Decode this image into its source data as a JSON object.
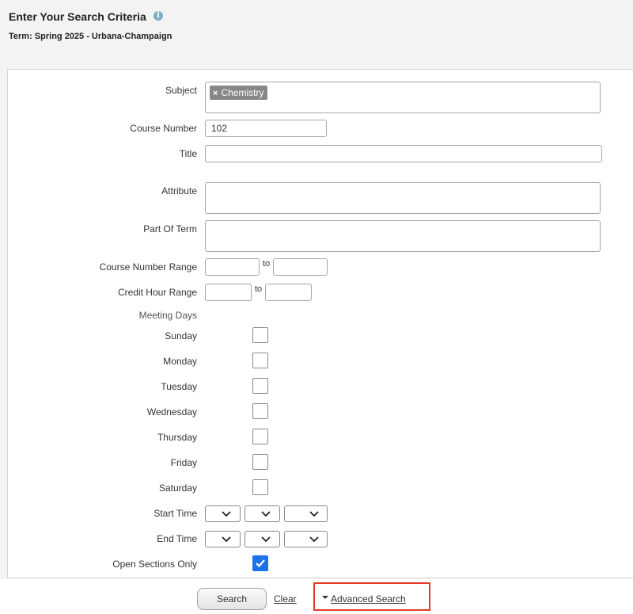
{
  "header": {
    "title": "Enter Your Search Criteria",
    "info_icon": "info-icon",
    "term": "Term: Spring 2025 - Urbana-Champaign"
  },
  "form": {
    "subject": {
      "label": "Subject",
      "chips": [
        "Chemistry"
      ]
    },
    "course_number": {
      "label": "Course Number",
      "value": "102"
    },
    "title": {
      "label": "Title",
      "value": ""
    },
    "attribute": {
      "label": "Attribute"
    },
    "part_of_term": {
      "label": "Part Of Term"
    },
    "course_number_range": {
      "label": "Course Number Range",
      "to": "to",
      "from_value": "",
      "to_value": ""
    },
    "credit_hour_range": {
      "label": "Credit Hour Range",
      "to": "to",
      "from_value": "",
      "to_value": ""
    },
    "meeting_days": {
      "label": "Meeting Days",
      "days": [
        {
          "label": "Sunday",
          "checked": false
        },
        {
          "label": "Monday",
          "checked": false
        },
        {
          "label": "Tuesday",
          "checked": false
        },
        {
          "label": "Wednesday",
          "checked": false
        },
        {
          "label": "Thursday",
          "checked": false
        },
        {
          "label": "Friday",
          "checked": false
        },
        {
          "label": "Saturday",
          "checked": false
        }
      ]
    },
    "start_time": {
      "label": "Start Time"
    },
    "end_time": {
      "label": "End Time"
    },
    "open_sections": {
      "label": "Open Sections Only",
      "checked": true
    }
  },
  "footer": {
    "search_label": "Search",
    "clear_label": "Clear",
    "advanced_label": "Advanced Search"
  },
  "colors": {
    "checkbox_checked": "#1a73e8",
    "highlight_border": "#e53a2a",
    "chip_bg": "#878787"
  }
}
